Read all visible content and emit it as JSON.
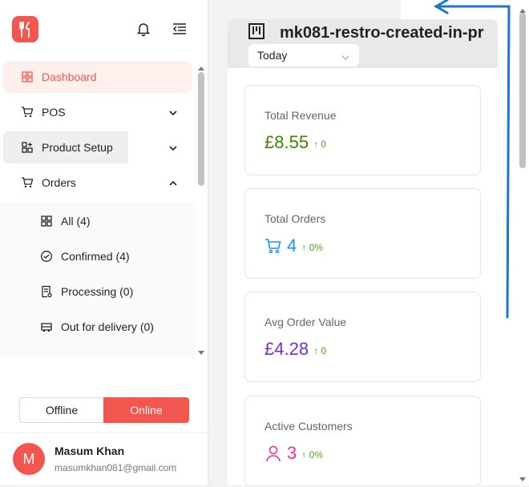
{
  "sidebar": {
    "menu": {
      "dashboard": "Dashboard",
      "pos": "POS",
      "product_setup": "Product Setup",
      "orders": "Orders"
    },
    "orders_submenu": [
      {
        "label": "All (4)",
        "icon": "grid-icon"
      },
      {
        "label": "Confirmed (4)",
        "icon": "check-circle-icon"
      },
      {
        "label": "Processing (0)",
        "icon": "receipt-icon"
      },
      {
        "label": "Out for delivery (0)",
        "icon": "truck-icon"
      }
    ],
    "status_toggle": {
      "offline": "Offline",
      "online": "Online",
      "selected": "Online"
    },
    "user": {
      "initial": "M",
      "name": "Masum Khan",
      "email": "masumkhan081@gmail.com"
    }
  },
  "main": {
    "store_name": "mk081-restro-created-in-pr",
    "period": "Today",
    "cards": [
      {
        "title": "Total Revenue",
        "value": "£8.55",
        "delta": "↑ 0",
        "color": "#3f8600"
      },
      {
        "title": "Total Orders",
        "value": "4",
        "delta": "↑ 0%",
        "color": "#1890ff",
        "icon": "cart-icon"
      },
      {
        "title": "Avg Order Value",
        "value": "£4.28",
        "delta": "↑ 0",
        "color": "#722ed1"
      },
      {
        "title": "Active Customers",
        "value": "3",
        "delta": "↑ 0%",
        "color": "#eb2f96",
        "icon": "user-icon"
      }
    ]
  },
  "colors": {
    "brand": "#f2564f",
    "annotation": "#1976d2"
  }
}
